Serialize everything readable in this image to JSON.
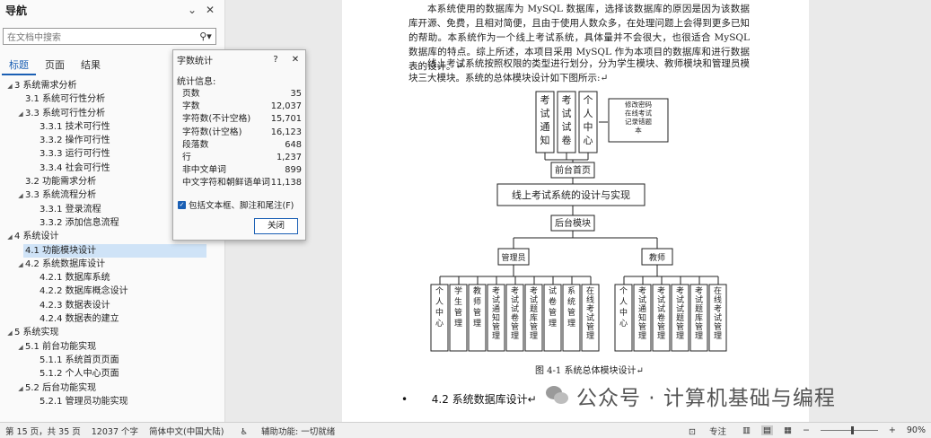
{
  "nav": {
    "title": "导航",
    "search_placeholder": "在文档中搜索",
    "tabs": [
      {
        "label": "标题",
        "active": true
      },
      {
        "label": "页面"
      },
      {
        "label": "结果"
      }
    ],
    "items": [
      {
        "label": "3 系统需求分析",
        "level": 0,
        "tri": true
      },
      {
        "label": "3.1 系统可行性分析",
        "level": 1
      },
      {
        "label": "3.3 系统可行性分析",
        "level": 1,
        "tri": true
      },
      {
        "label": "3.3.1 技术可行性",
        "level": 2
      },
      {
        "label": "3.3.2 操作可行性",
        "level": 2
      },
      {
        "label": "3.3.3 运行可行性",
        "level": 2
      },
      {
        "label": "3.3.4 社会可行性",
        "level": 2
      },
      {
        "label": "3.2 功能需求分析",
        "level": 1
      },
      {
        "label": "3.3 系统流程分析",
        "level": 1,
        "tri": true
      },
      {
        "label": "3.3.1 登录流程",
        "level": 2
      },
      {
        "label": "3.3.2 添加信息流程",
        "level": 2
      },
      {
        "label": "4 系统设计",
        "level": 0,
        "tri": true
      },
      {
        "label": "4.1 功能模块设计",
        "level": 1,
        "selected": true
      },
      {
        "label": "4.2 系统数据库设计",
        "level": 1,
        "tri": true
      },
      {
        "label": "4.2.1 数据库系统",
        "level": 2
      },
      {
        "label": "4.2.2 数据库概念设计",
        "level": 2
      },
      {
        "label": "4.2.3 数据表设计",
        "level": 2
      },
      {
        "label": "4.2.4 数据表的建立",
        "level": 2
      },
      {
        "label": "5 系统实现",
        "level": 0,
        "tri": true
      },
      {
        "label": "5.1 前台功能实现",
        "level": 1,
        "tri": true
      },
      {
        "label": "5.1.1 系统首页页面",
        "level": 2
      },
      {
        "label": "5.1.2 个人中心页面",
        "level": 2
      },
      {
        "label": "5.2 后台功能实现",
        "level": 1,
        "tri": true
      },
      {
        "label": "5.2.1 管理员功能实现",
        "level": 2
      }
    ]
  },
  "dialog": {
    "title": "字数统计",
    "help": "?",
    "section": "统计信息:",
    "stats": [
      {
        "k": "页数",
        "v": "35"
      },
      {
        "k": "字数",
        "v": "12,037"
      },
      {
        "k": "字符数(不计空格)",
        "v": "15,701"
      },
      {
        "k": "字符数(计空格)",
        "v": "16,123"
      },
      {
        "k": "段落数",
        "v": "648"
      },
      {
        "k": "行",
        "v": "1,237"
      },
      {
        "k": "非中文单词",
        "v": "899"
      },
      {
        "k": "中文字符和朝鲜语单词",
        "v": "11,138"
      }
    ],
    "checkbox_label": "包括文本框、脚注和尾注(F)",
    "close_label": "关闭"
  },
  "doc": {
    "para1": "本系统使用的数据库为 MySQL 数据库，选择该数据库的原因是因为该数据库开源、免费，且相对简便，且由于使用人数众多，在处理问题上会得到更多已知的帮助。本系统作为一个线上考试系统，具体量并不会很大，也很适合 MySQL 数据库的特点。综上所述，本项目采用 MySQL 作为本项目的数据库和进行数据表的设计。↵",
    "para2": "线上考试系统按照权限的类型进行划分，分为学生模块、教师模块和管理员模块三大模块。系统的总体模块设计如下图所示:↵",
    "diagram": {
      "top_boxes": [
        "考试通知",
        "考试试卷",
        "个人中心"
      ],
      "note": "修改密码在线考试记录错题本",
      "front": "前台首页",
      "system": "线上考试系统的设计与实现",
      "back": "后台模块",
      "admin": "管理员",
      "teacher": "教师",
      "admin_items": [
        "个人中心",
        "学生管理",
        "教师管理",
        "考试通知管理",
        "考试试卷管理",
        "考试题库管理",
        "试卷管理",
        "系统管理",
        "在线考试管理"
      ],
      "teacher_items": [
        "个人中心",
        "考试通知管理",
        "考试试卷管理",
        "考试试题管理",
        "考试题库管理",
        "在线考试管理"
      ]
    },
    "caption": "图 4-1  系统总体模块设计↵",
    "heading": "4.2  系统数据库设计↵"
  },
  "watermark": "公众号 · 计算机基础与编程",
  "status": {
    "page": "第 15 页，共 35 页",
    "words": "12037 个字",
    "lang": "简体中文(中国大陆)",
    "access": "辅助功能: 一切就绪",
    "focus": "专注",
    "zoom": "90%"
  }
}
